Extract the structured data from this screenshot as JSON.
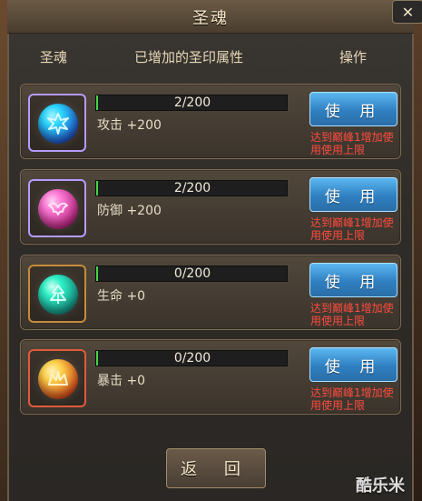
{
  "window": {
    "title": "圣魂"
  },
  "table_headers": [
    "圣魂",
    "已增加的圣印属性",
    "操作"
  ],
  "items": [
    {
      "progress": "2/200",
      "progress_fraction": 0.01,
      "attribute": "攻击 +200",
      "button": "使 用",
      "note": "达到巅峰1增加使用使用上限",
      "colors": {
        "frame": "#b59bff",
        "orb_a": "#2bd7ff",
        "orb_b": "#1f4fbf",
        "glyph": "#d7f7ff"
      },
      "icon": "wing-rune"
    },
    {
      "progress": "2/200",
      "progress_fraction": 0.01,
      "attribute": "防御 +200",
      "button": "使 用",
      "note": "达到巅峰1增加使用使用上限",
      "colors": {
        "frame": "#b59bff",
        "orb_a": "#ff7ad7",
        "orb_b": "#b4237b",
        "glyph": "#ffe2f4"
      },
      "icon": "wing-rune"
    },
    {
      "progress": "0/200",
      "progress_fraction": 0.0,
      "attribute": "生命 +0",
      "button": "使 用",
      "note": "达到巅峰1增加使用使用上限",
      "colors": {
        "frame": "#c58b3a",
        "orb_a": "#2ef2c7",
        "orb_b": "#138a7d",
        "glyph": "#d9fff6"
      },
      "icon": "leaf-rune"
    },
    {
      "progress": "0/200",
      "progress_fraction": 0.0,
      "attribute": "暴击 +0",
      "button": "使 用",
      "note": "达到巅峰1增加使用使用上限",
      "colors": {
        "frame": "#e15a3a",
        "orb_a": "#ffd24a",
        "orb_b": "#d14b1b",
        "glyph": "#fff4cc"
      },
      "icon": "crown-rune"
    }
  ],
  "footer": {
    "back_button": "返 回"
  },
  "watermark": "酷乐米",
  "close_symbol": "✕"
}
